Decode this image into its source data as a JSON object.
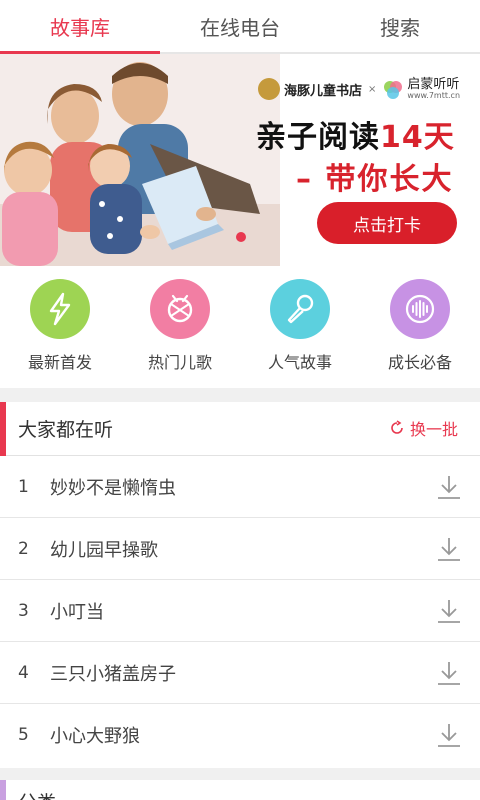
{
  "tabs": [
    {
      "label": "故事库",
      "active": true
    },
    {
      "label": "在线电台",
      "active": false
    },
    {
      "label": "搜索",
      "active": false
    }
  ],
  "banner": {
    "partner1": "海豚儿童书店",
    "partner_separator": "×",
    "partner2": "启蒙听听",
    "partner2_url": "www.7mtt.cn",
    "headline_black": "亲子阅读",
    "headline_red": "14天",
    "subline": "– 带你长大",
    "button_label": "点击打卡",
    "accent": "#d91f2a"
  },
  "categories": [
    {
      "label": "最新首发",
      "icon": "lightning-icon",
      "color": "#9ed453"
    },
    {
      "label": "热门儿歌",
      "icon": "drum-icon",
      "color": "#f27ea3"
    },
    {
      "label": "人气故事",
      "icon": "microphone-icon",
      "color": "#5cd0de"
    },
    {
      "label": "成长必备",
      "icon": "soundwave-icon",
      "color": "#c792e4"
    }
  ],
  "listen": {
    "title": "大家都在听",
    "refresh_label": "换一批",
    "items": [
      {
        "num": "1",
        "title": "妙妙不是懒惰虫"
      },
      {
        "num": "2",
        "title": "幼儿园早操歌"
      },
      {
        "num": "3",
        "title": "小叮当"
      },
      {
        "num": "4",
        "title": "三只小猪盖房子"
      },
      {
        "num": "5",
        "title": "小心大野狼"
      }
    ]
  },
  "section2": {
    "title": "分类"
  },
  "colors": {
    "accent": "#e8384f",
    "background": "#f0f0f0"
  }
}
